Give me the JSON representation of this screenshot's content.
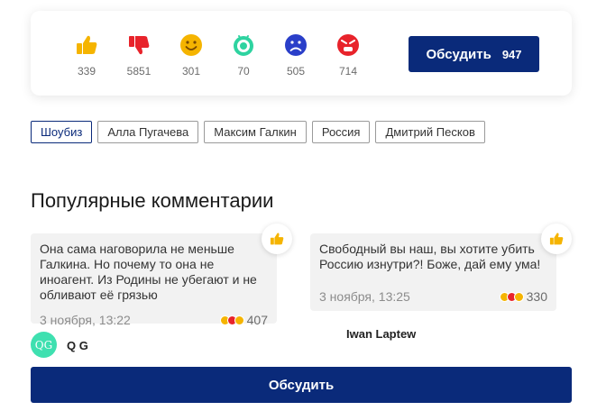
{
  "reactions": [
    {
      "icon": "thumbs-up-icon",
      "count": "339",
      "color": "#f5b400"
    },
    {
      "icon": "thumbs-down-icon",
      "count": "5851",
      "color": "#e8232b"
    },
    {
      "icon": "smile-icon",
      "count": "301",
      "color": "#f5b400"
    },
    {
      "icon": "surprised-icon",
      "count": "70",
      "color": "#2ed3a0"
    },
    {
      "icon": "sad-icon",
      "count": "505",
      "color": "#2a3fc9"
    },
    {
      "icon": "angry-icon",
      "count": "714",
      "color": "#e8232b"
    }
  ],
  "discuss_top": {
    "label": "Обсудить",
    "count": "947"
  },
  "tags": [
    "Шоубиз",
    "Алла Пугачева",
    "Максим Галкин",
    "Россия",
    "Дмитрий Песков"
  ],
  "popular": {
    "title": "Популярные комментарии",
    "comments": [
      {
        "text": "Она сама наговорила не меньше Галкина. Но почему то она не иноагент. Из Родины не убегают и не обливают её грязью",
        "date": "3 ноября, 13:22",
        "reactions": "407",
        "author": "Q G",
        "avatar": "QG"
      },
      {
        "text": "Свободный вы наш, вы хотите убить Россию изнутри?! Боже, дай ему ума!",
        "date": "3 ноября, 13:25",
        "reactions": "330",
        "author": "Iwan Laptew"
      }
    ]
  },
  "discuss_bottom": {
    "label": "Обсудить"
  },
  "colors": {
    "brand": "#0a2a7a",
    "accent_yellow": "#f5b400",
    "accent_red": "#e8232b"
  }
}
